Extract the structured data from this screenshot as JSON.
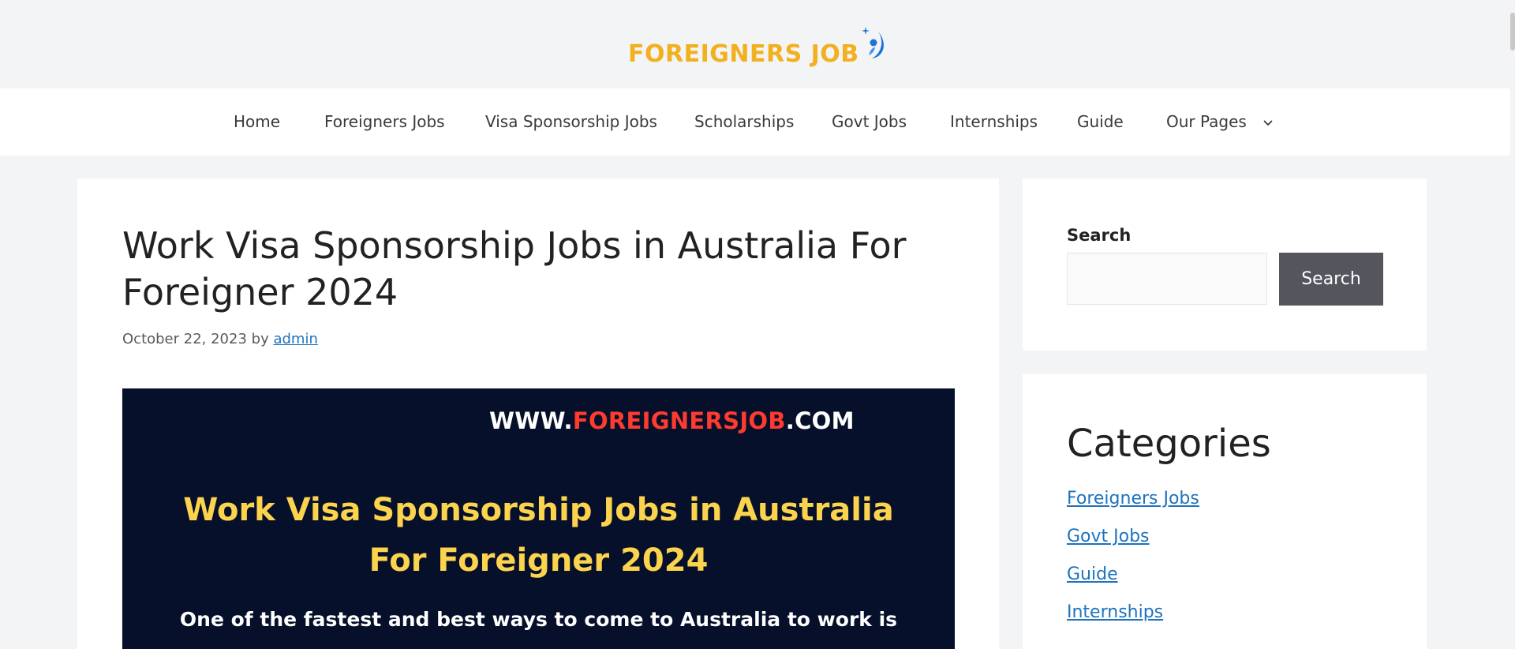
{
  "header": {
    "logo_text": "FOREIGNERS JOB",
    "logo_icon": "rocket-swoosh-icon",
    "colors": {
      "logo": "#f2b01e",
      "logo_mark": "#1e73d8"
    }
  },
  "nav": {
    "items": [
      {
        "label": "Home"
      },
      {
        "label": "Foreigners Jobs"
      },
      {
        "label": "Visa Sponsorship Jobs"
      },
      {
        "label": "Scholarships"
      },
      {
        "label": "Govt Jobs"
      },
      {
        "label": "Internships"
      },
      {
        "label": "Guide"
      },
      {
        "label": "Our Pages",
        "icon": "chevron-down-icon"
      }
    ]
  },
  "article": {
    "title": "Work Visa Sponsorship Jobs in Australia For Foreigner 2024",
    "date": "October 22, 2023",
    "by": "by",
    "author": "admin",
    "banner": {
      "url_prefix": "WWW.",
      "url_brand": "FOREIGNERSJOB",
      "url_suffix": ".COM",
      "title": "Work Visa Sponsorship Jobs in Australia For Foreigner 2024",
      "body": "One of the fastest and best ways to come to Australia to work is",
      "colors": {
        "background": "#06102b",
        "title": "#fcd34d",
        "brand": "#ff3a2e"
      }
    }
  },
  "sidebar": {
    "search": {
      "label": "Search",
      "placeholder": "",
      "value": "",
      "button_label": "Search"
    },
    "categories": {
      "title": "Categories",
      "items": [
        {
          "label": "Foreigners Jobs"
        },
        {
          "label": "Govt Jobs"
        },
        {
          "label": "Guide"
        },
        {
          "label": "Internships"
        }
      ]
    }
  },
  "colors": {
    "link": "#1e73be",
    "page_bg": "#f3f4f5",
    "button": "#55555e"
  }
}
